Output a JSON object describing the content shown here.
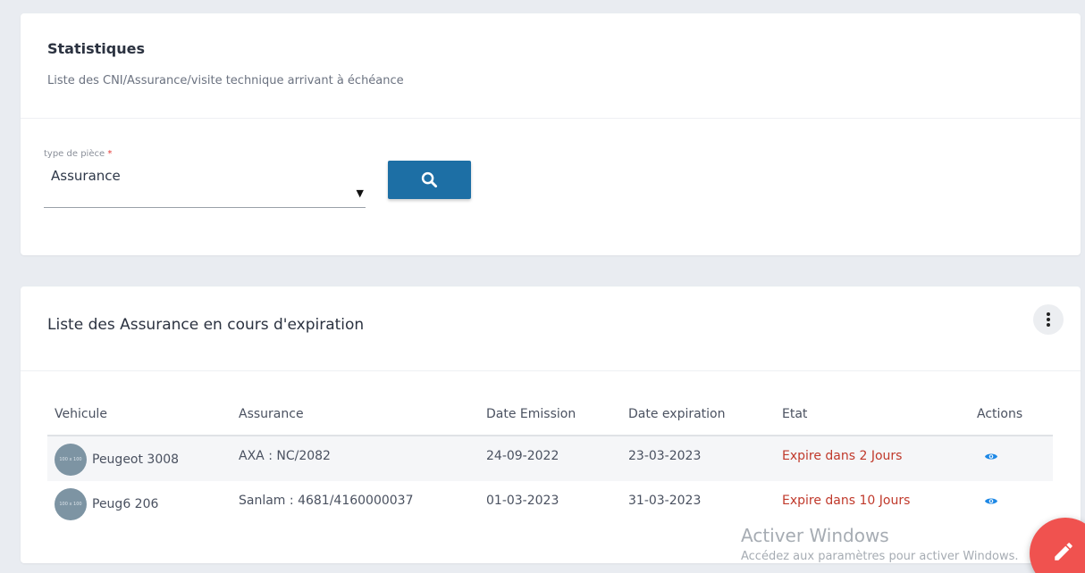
{
  "stats": {
    "title": "Statistiques",
    "subtitle": "Liste des CNI/Assurance/visite technique arrivant à échéance",
    "field_label": "type de pièce",
    "required_mark": "*",
    "selected_type": "Assurance",
    "caret": "▼",
    "search_icon": "search-icon"
  },
  "list": {
    "title": "Liste des Assurance en cours d'expiration",
    "menu_icon": "more-vertical-icon",
    "columns": [
      "Vehicule",
      "Assurance",
      "Date Emission",
      "Date expiration",
      "Etat",
      "Actions"
    ],
    "rows": [
      {
        "avatar_text": "100 x 100",
        "vehicule": "Peugeot 3008",
        "assurance": "AXA : NC/2082",
        "date_emission": "24-09-2022",
        "date_expiration": "23-03-2023",
        "etat": "Expire dans 2 Jours",
        "action_icon": "eye-icon"
      },
      {
        "avatar_text": "100 x 100",
        "vehicule": "Peug6 206",
        "assurance": "Sanlam : 4681/4160000037",
        "date_emission": "01-03-2023",
        "date_expiration": "31-03-2023",
        "etat": "Expire dans 10 Jours",
        "action_icon": "eye-icon"
      }
    ]
  },
  "watermark": {
    "line1": "Activer Windows",
    "line2": "Accédez aux paramètres pour activer Windows."
  },
  "fab": {
    "icon": "pencil-icon"
  },
  "colors": {
    "primary": "#1d6fa5",
    "danger": "#c0392b",
    "fab": "#f0524f",
    "eye": "#1e88e5",
    "background": "#e9ecf1"
  }
}
